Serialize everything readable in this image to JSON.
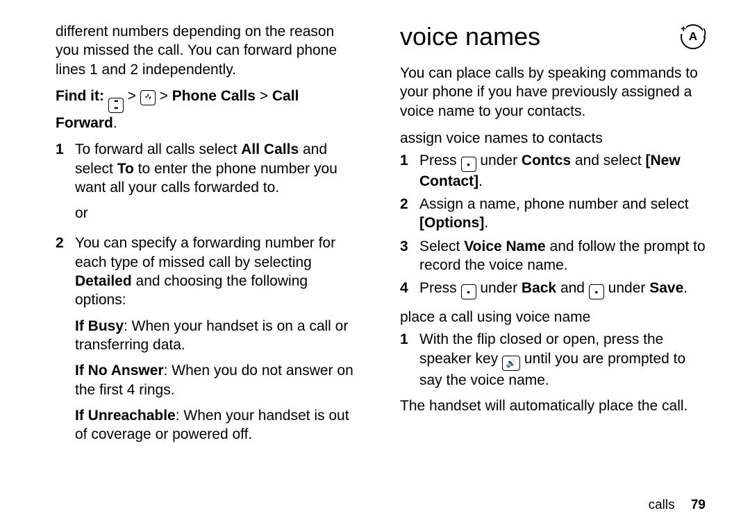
{
  "left": {
    "intro": "different numbers depending on the reason you missed the call. You can forward phone lines 1 and 2 independently.",
    "find_it_label": "Find it:",
    "find_it_path_1": "Phone Calls",
    "find_it_path_2": "Call Forward",
    "step1_num": "1",
    "step1_a": "To forward all calls select ",
    "step1_bold1": "All Calls",
    "step1_b": " and select ",
    "step1_bold2": "To",
    "step1_c": " to enter the phone number you want all your calls forwarded to.",
    "or_text": "or",
    "step2_num": "2",
    "step2_a": "You can specify a forwarding number for each type of missed call by selecting ",
    "step2_bold1": "Detailed",
    "step2_b": " and choosing the following options:",
    "busy_label": "If Busy",
    "busy_text": ": When your handset is on a call or transferring data.",
    "noans_label": "If No Answer",
    "noans_text": ": When you do not answer on the first 4 rings.",
    "unreach_label": "If Unreachable",
    "unreach_text": ": When your handset is out of coverage or powered off."
  },
  "right": {
    "title": "voice names",
    "intro": "You can place calls by speaking commands to your phone if you have previously assigned a voice name to your contacts.",
    "sub1": "assign voice names to contacts",
    "r1_num": "1",
    "r1_a": "Press ",
    "r1_b": " under ",
    "r1_bold1": "Contcs",
    "r1_c": " and select ",
    "r1_bold2": "[New Contact]",
    "r1_d": ".",
    "r2_num": "2",
    "r2_a": "Assign a name, phone number and select ",
    "r2_bold1": "[Options]",
    "r2_b": ".",
    "r3_num": "3",
    "r3_a": "Select ",
    "r3_bold1": "Voice Name",
    "r3_b": " and follow the prompt to record the voice name.",
    "r4_num": "4",
    "r4_a": "Press ",
    "r4_b": " under ",
    "r4_bold1": "Back",
    "r4_c": " and ",
    "r4_d": " under ",
    "r4_bold2": "Save",
    "r4_e": ".",
    "sub2": "place a call using voice name",
    "p1_num": "1",
    "p1_a": "With the flip closed or open, press the speaker key ",
    "p1_b": " until you are prompted to say the voice name.",
    "closing": "The handset will automatically place the call."
  },
  "footer": {
    "section": "calls",
    "page": "79"
  }
}
